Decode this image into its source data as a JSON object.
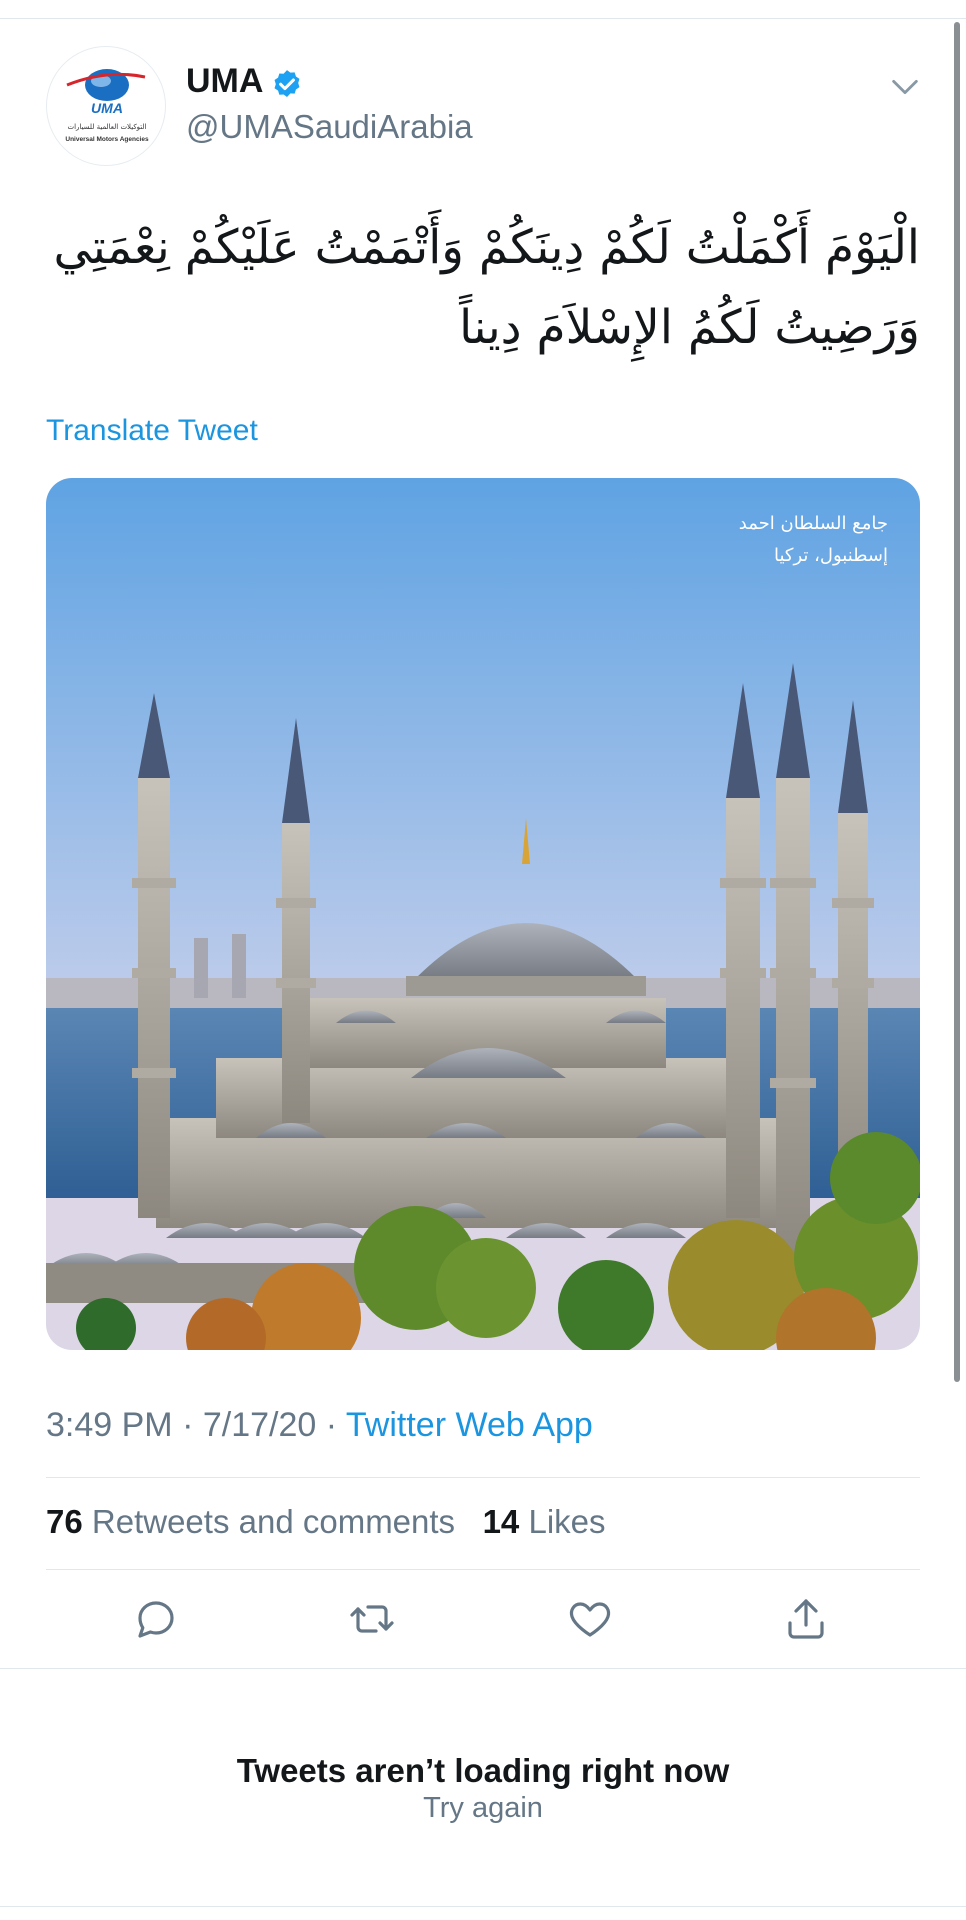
{
  "user": {
    "name": "UMA",
    "handle": "@UMASaudiArabia",
    "avatar_logo_text": "UMA",
    "avatar_arabic": "التوكيلات العالمية للسيارات",
    "avatar_english": "Universal Motors Agencies",
    "verified_icon": "verified-badge-icon"
  },
  "tweet": {
    "text_line_1": "الْيَوْمَ أَكْمَلْتُ لَكُمْ دِينَكُمْ وَأَتْمَمْتُ عَلَيْكُمْ نِعْمَتِي",
    "text_line_2": "وَرَضِيتُ لَكُمُ الإِسْلاَمَ دِيناً",
    "translate_label": "Translate Tweet",
    "media_caption_line_1": "جامع السلطان احمد",
    "media_caption_line_2": "إسطنبول، تركيا"
  },
  "meta": {
    "time": "3:49 PM",
    "sep1": " · ",
    "date": "7/17/20",
    "sep2": " · ",
    "source": "Twitter Web App"
  },
  "stats": {
    "retweets_count": "76",
    "retweets_label": "Retweets and comments",
    "likes_count": "14",
    "likes_label": "Likes"
  },
  "actions": {
    "reply_icon": "reply-icon",
    "retweet_icon": "retweet-icon",
    "like_icon": "heart-icon",
    "share_icon": "share-icon"
  },
  "error": {
    "title": "Tweets aren’t loading right now",
    "retry": "Try again"
  },
  "colors": {
    "link": "#1b95e0",
    "secondary_text": "#657786",
    "primary_text": "#14171a",
    "verified": "#1da1f2",
    "divider": "#e1e8ed"
  }
}
